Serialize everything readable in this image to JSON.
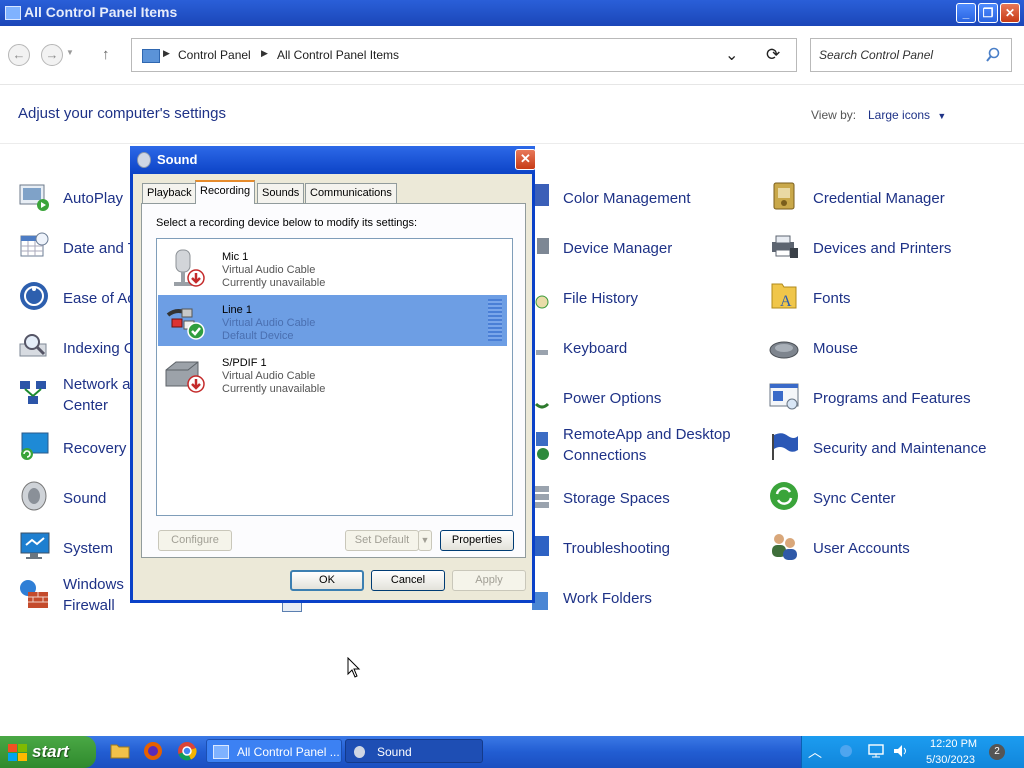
{
  "window": {
    "title": "All Control Panel Items",
    "minimize": "_",
    "restore": "❐",
    "close": "✕"
  },
  "nav": {
    "back": "←",
    "forward": "→",
    "up": "↑",
    "breadcrumb": [
      "Control Panel",
      "All Control Panel Items"
    ],
    "dropdown": "⌄",
    "refresh": "⟳",
    "search_placeholder": "Search Control Panel",
    "search_icon": "magnifier-icon"
  },
  "header": {
    "title": "Adjust your computer's settings",
    "view_by_label": "View by:",
    "view_mode": "Large icons"
  },
  "items": [
    {
      "label": "AutoPlay",
      "icon": "autoplay-icon"
    },
    {
      "label": "Date and T",
      "icon": "calendar-clock-icon"
    },
    {
      "label": "Ease of Ac",
      "icon": "ease-of-access-icon"
    },
    {
      "label": "Indexing O",
      "icon": "indexing-icon"
    },
    {
      "label1": "Network a",
      "label2": "Center",
      "icon": "network-icon"
    },
    {
      "label": "Recovery",
      "icon": "recovery-icon"
    },
    {
      "label": "Sound",
      "icon": "speaker-icon"
    },
    {
      "label": "System",
      "icon": "monitor-icon"
    },
    {
      "label1": "Windows",
      "label2": "Firewall",
      "icon": "firewall-icon"
    },
    {
      "label": "Color Management",
      "icon": "color-icon"
    },
    {
      "label": "Device Manager",
      "icon": "device-manager-icon"
    },
    {
      "label": "File History",
      "icon": "file-history-icon"
    },
    {
      "label": "Keyboard",
      "icon": "keyboard-icon"
    },
    {
      "label": "Power Options",
      "icon": "power-icon"
    },
    {
      "label1": "RemoteApp and Desktop",
      "label2": "Connections",
      "icon": "remoteapp-icon"
    },
    {
      "label": "Storage Spaces",
      "icon": "storage-icon"
    },
    {
      "label": "Troubleshooting",
      "icon": "troubleshoot-icon"
    },
    {
      "label": "Work Folders",
      "icon": "work-folders-icon"
    },
    {
      "label": "Credential Manager",
      "icon": "credential-icon"
    },
    {
      "label": "Devices and Printers",
      "icon": "printer-icon"
    },
    {
      "label": "Fonts",
      "icon": "fonts-icon"
    },
    {
      "label": "Mouse",
      "icon": "mouse-icon"
    },
    {
      "label": "Programs and Features",
      "icon": "programs-icon"
    },
    {
      "label": "Security and Maintenance",
      "icon": "flag-icon"
    },
    {
      "label": "Sync Center",
      "icon": "sync-icon"
    },
    {
      "label": "User Accounts",
      "icon": "users-icon"
    }
  ],
  "dialog": {
    "title": "Sound",
    "close": "✕",
    "tabs": [
      "Playback",
      "Recording",
      "Sounds",
      "Communications"
    ],
    "active_tab": "Recording",
    "instruction": "Select a recording device below to modify its settings:",
    "devices": [
      {
        "name": "Mic 1",
        "driver": "Virtual Audio Cable",
        "status": "Currently unavailable",
        "icon": "microphone-icon",
        "badge": "down-arrow-badge"
      },
      {
        "name": "Line 1",
        "driver": "Virtual Audio Cable",
        "status": "Default Device",
        "icon": "audio-cable-icon",
        "badge": "checkmark-badge",
        "selected": true
      },
      {
        "name": "S/PDIF 1",
        "driver": "Virtual Audio Cable",
        "status": "Currently unavailable",
        "icon": "spdif-device-icon",
        "badge": "down-arrow-badge"
      }
    ],
    "buttons": {
      "configure": "Configure",
      "set_default": "Set Default",
      "properties": "Properties",
      "ok": "OK",
      "cancel": "Cancel",
      "apply": "Apply"
    }
  },
  "taskbar": {
    "start": "start",
    "tasks": [
      "All Control Panel ...",
      "Sound"
    ],
    "time": "12:20 PM",
    "date": "5/30/2023",
    "notification_count": "2"
  }
}
